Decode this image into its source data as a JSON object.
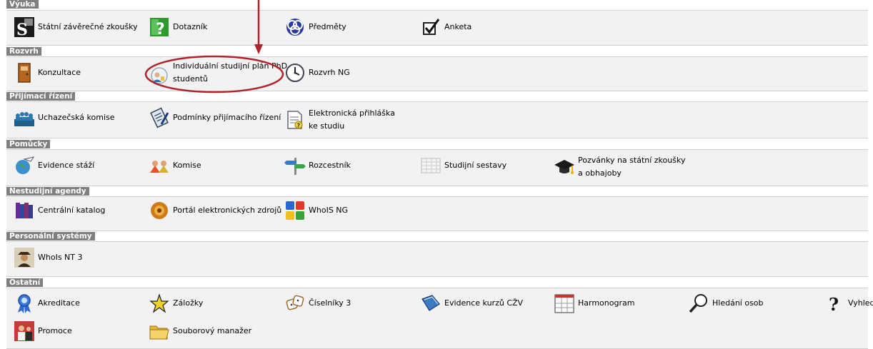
{
  "sections": [
    {
      "title": "Výuka",
      "items": [
        {
          "label": "Státní závěrečné zkoušky",
          "icon": "szz-icon"
        },
        {
          "label": "Dotazník",
          "icon": "questionnaire-icon"
        },
        {
          "label": "Předměty",
          "icon": "subjects-knot-icon"
        },
        {
          "label": "Anketa",
          "icon": "checkbox-survey-icon"
        }
      ]
    },
    {
      "title": "Rozvrh",
      "items": [
        {
          "label": "Konzultace",
          "icon": "door-icon"
        },
        {
          "label": "Individuální studijní plán PhD. studentů",
          "icon": "study-plan-icon"
        },
        {
          "label": "Rozvrh NG",
          "icon": "clock-icon"
        }
      ]
    },
    {
      "title": "Přijímací řízení",
      "items": [
        {
          "label": "Uchazečská komise",
          "icon": "committee-people-icon"
        },
        {
          "label": "Podmínky přijímacího řízení",
          "icon": "clipboard-pen-icon"
        },
        {
          "label": "Elektronická přihláška ke studiu",
          "icon": "application-document-icon"
        }
      ]
    },
    {
      "title": "Pomůcky",
      "items": [
        {
          "label": "Evidence stáží",
          "icon": "globe-plane-icon"
        },
        {
          "label": "Komise",
          "icon": "group-icon"
        },
        {
          "label": "Rozcestník",
          "icon": "signpost-icon"
        },
        {
          "label": "Studijní sestavy",
          "icon": "report-grid-icon"
        },
        {
          "label": "Pozvánky na státní zkoušky a obhajoby",
          "icon": "graduation-cap-icon"
        }
      ]
    },
    {
      "title": "Nestudijní agendy",
      "items": [
        {
          "label": "Centrální katalog",
          "icon": "books-icon"
        },
        {
          "label": "Portál elektronických zdrojů",
          "icon": "portal-icon"
        },
        {
          "label": "WhoIS NG",
          "icon": "colored-squares-icon"
        }
      ]
    },
    {
      "title": "Personální systémy",
      "items": [
        {
          "label": "WhoIs NT 3",
          "icon": "person-hat-icon"
        }
      ]
    },
    {
      "title": "Ostatní",
      "items": [
        {
          "label": "Akreditace",
          "icon": "award-ribbon-icon"
        },
        {
          "label": "Záložky",
          "icon": "star-bookmark-icon"
        },
        {
          "label": "Číselníky 3",
          "icon": "dice-icon"
        },
        {
          "label": "Evidence kurzů CŽV",
          "icon": "book-blue-icon"
        },
        {
          "label": "Harmonogram",
          "icon": "calendar-icon"
        },
        {
          "label": "Hledání osob",
          "icon": "magnifier-icon"
        },
        {
          "label": "Vyhled",
          "icon": "question-mark-icon"
        },
        {
          "label": "Promoce",
          "icon": "graduation-ceremony-icon"
        },
        {
          "label": "Souborový manažer",
          "icon": "folder-icon"
        }
      ]
    }
  ],
  "colors": {
    "section_header": "#7f7f7f",
    "band": "#f2f2f2",
    "annotation": "#b0232a"
  }
}
